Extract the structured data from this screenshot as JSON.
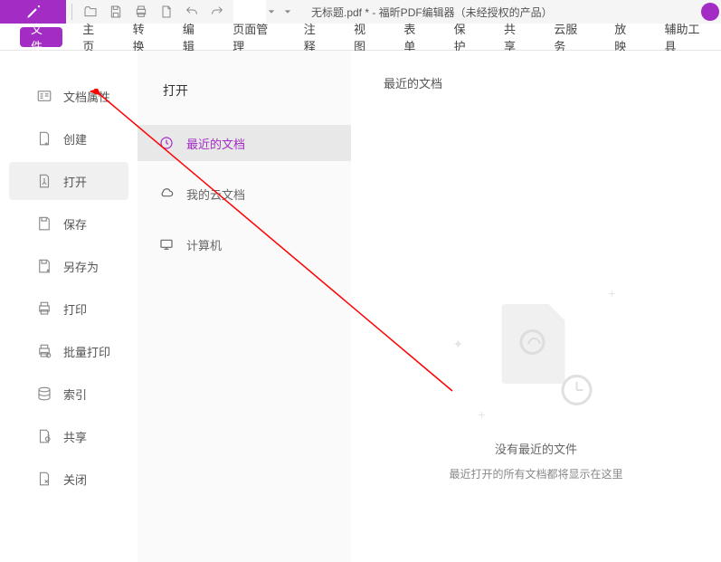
{
  "titlebar": {
    "title": "无标题.pdf * - 福昕PDF编辑器（未经授权的产品）"
  },
  "menubar": {
    "items": [
      {
        "label": "文件",
        "active": true
      },
      {
        "label": "主页",
        "active": false
      },
      {
        "label": "转换",
        "active": false
      },
      {
        "label": "编辑",
        "active": false
      },
      {
        "label": "页面管理",
        "active": false
      },
      {
        "label": "注释",
        "active": false
      },
      {
        "label": "视图",
        "active": false
      },
      {
        "label": "表单",
        "active": false
      },
      {
        "label": "保护",
        "active": false
      },
      {
        "label": "共享",
        "active": false
      },
      {
        "label": "云服务",
        "active": false
      },
      {
        "label": "放映",
        "active": false
      },
      {
        "label": "辅助工具",
        "active": false
      }
    ]
  },
  "sidebar1": {
    "items": [
      {
        "label": "文档属性",
        "icon": "properties",
        "active": false
      },
      {
        "label": "创建",
        "icon": "create",
        "active": false
      },
      {
        "label": "打开",
        "icon": "open",
        "active": true
      },
      {
        "label": "保存",
        "icon": "save",
        "active": false
      },
      {
        "label": "另存为",
        "icon": "saveas",
        "active": false
      },
      {
        "label": "打印",
        "icon": "print",
        "active": false
      },
      {
        "label": "批量打印",
        "icon": "batchprint",
        "active": false
      },
      {
        "label": "索引",
        "icon": "index",
        "active": false
      },
      {
        "label": "共享",
        "icon": "share",
        "active": false
      },
      {
        "label": "关闭",
        "icon": "close",
        "active": false
      }
    ]
  },
  "sidebar2": {
    "title": "打开",
    "items": [
      {
        "label": "最近的文档",
        "icon": "recent",
        "active": true
      },
      {
        "label": "我的云文档",
        "icon": "cloud",
        "active": false
      },
      {
        "label": "计算机",
        "icon": "computer",
        "active": false
      }
    ]
  },
  "main": {
    "title": "最近的文档",
    "empty_title": "没有最近的文件",
    "empty_desc": "最近打开的所有文档都将显示在这里"
  }
}
